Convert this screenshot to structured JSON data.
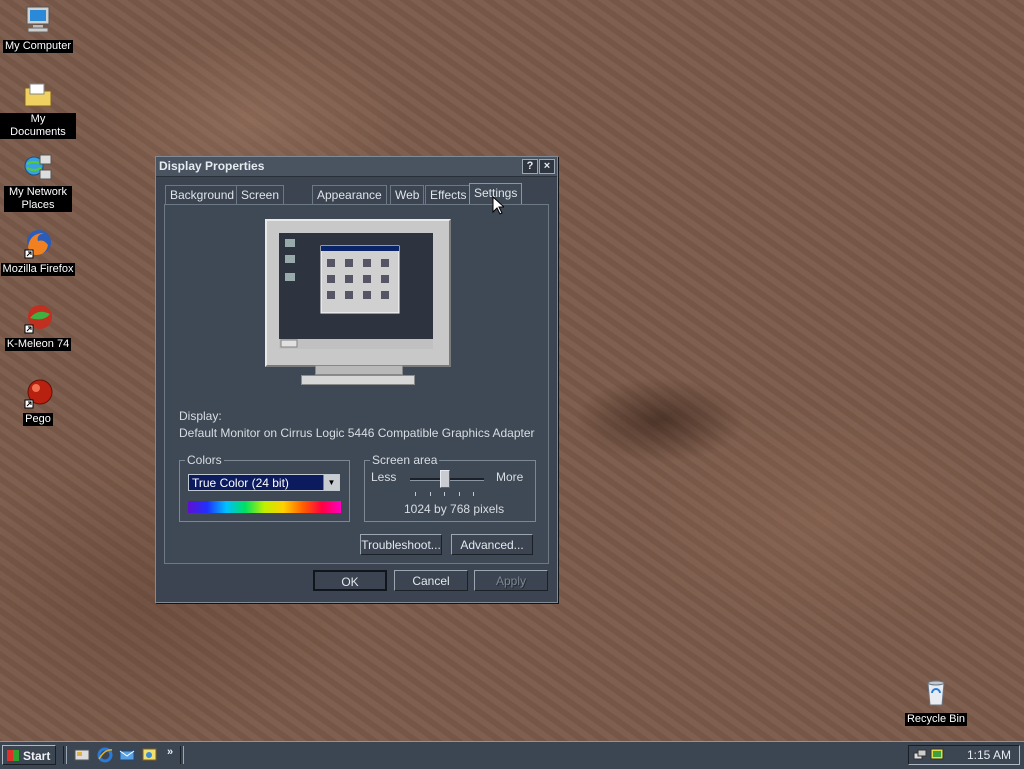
{
  "desktop": {
    "icons": [
      {
        "label": "My Computer"
      },
      {
        "label": "My Documents"
      },
      {
        "label": "My Network Places"
      },
      {
        "label": "Mozilla Firefox"
      },
      {
        "label": "K-Meleon 74"
      },
      {
        "label": "Pego"
      },
      {
        "label": "Recycle Bin"
      }
    ]
  },
  "dialog": {
    "title": "Display Properties",
    "help_button": "?",
    "close_button": "×",
    "tabs": [
      {
        "label": "Background"
      },
      {
        "label": "Screen Saver"
      },
      {
        "label": "Appearance"
      },
      {
        "label": "Web"
      },
      {
        "label": "Effects"
      },
      {
        "label": "Settings",
        "active": true
      }
    ],
    "display_label": "Display:",
    "display_value": "Default Monitor on Cirrus Logic 5446 Compatible Graphics Adapter",
    "colors": {
      "group_title": "Colors",
      "selected": "True Color (24 bit)"
    },
    "screen_area": {
      "group_title": "Screen area",
      "less_label": "Less",
      "more_label": "More",
      "resolution": "1024 by 768 pixels",
      "slider_level": 0.5
    },
    "buttons": {
      "troubleshoot": "Troubleshoot...",
      "advanced": "Advanced...",
      "ok": "OK",
      "cancel": "Cancel",
      "apply": "Apply"
    }
  },
  "taskbar": {
    "start_label": "Start",
    "clock": "1:15 AM"
  }
}
